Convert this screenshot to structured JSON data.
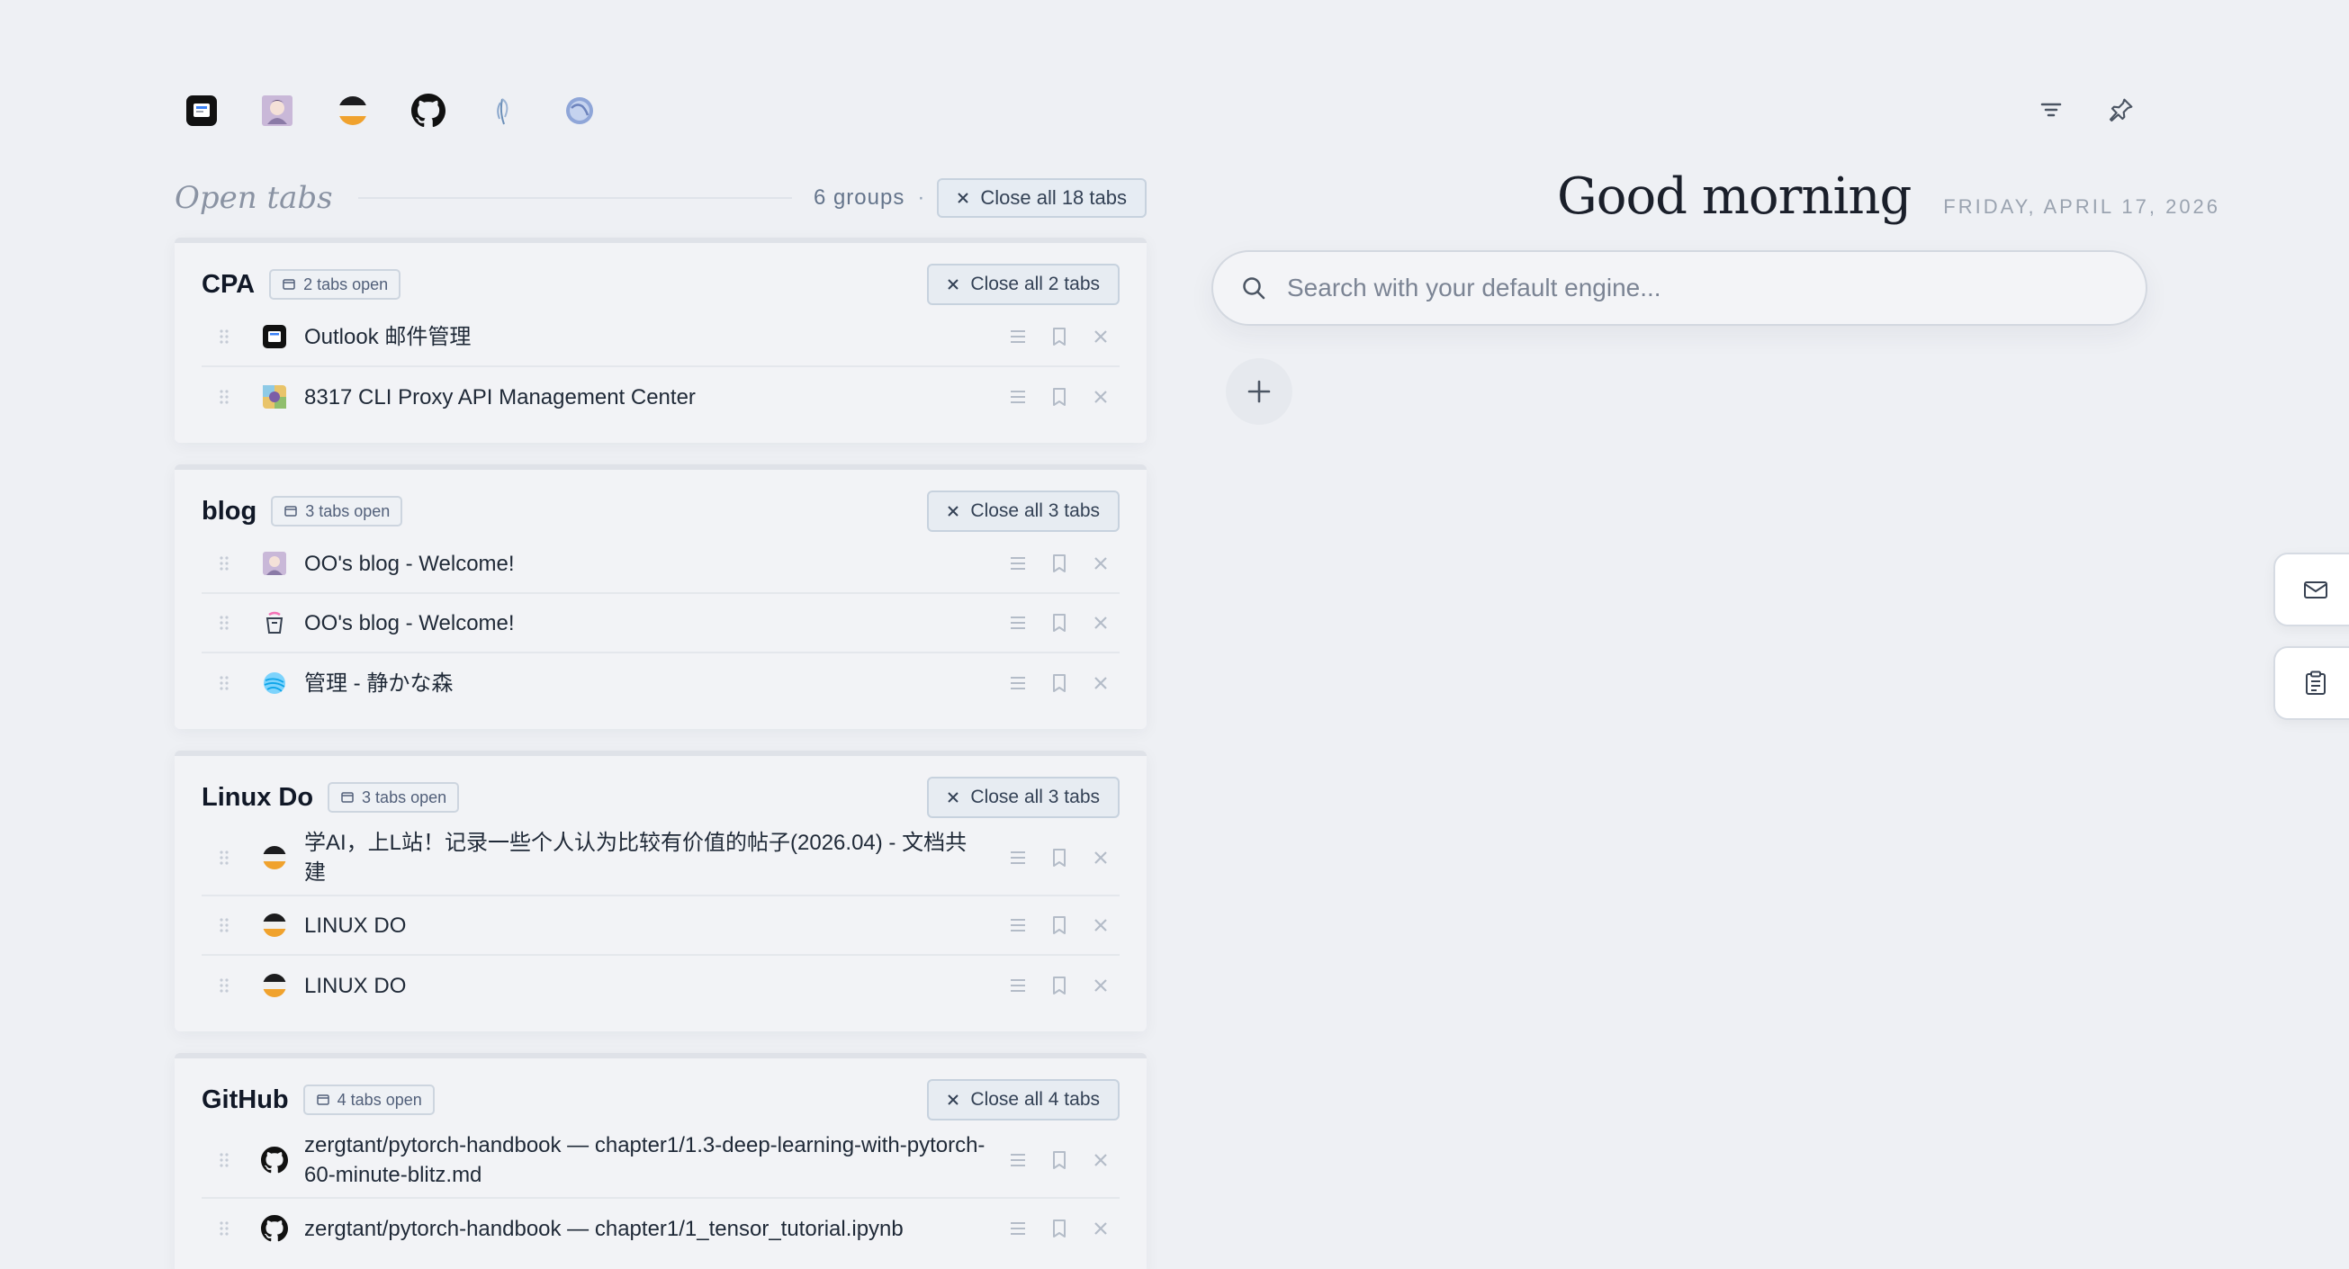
{
  "quick_links": [
    {
      "name": "outlook",
      "icon": "outlook-icon"
    },
    {
      "name": "blog-avatar",
      "icon": "anime-avatar-icon"
    },
    {
      "name": "linux-do",
      "icon": "linuxdo-icon"
    },
    {
      "name": "github",
      "icon": "github-icon"
    },
    {
      "name": "feather",
      "icon": "feather-icon"
    },
    {
      "name": "globe",
      "icon": "globe-icon"
    }
  ],
  "open_tabs": {
    "title": "Open tabs",
    "groups_count": "6 groups",
    "separator": "·",
    "close_all_label": "Close all 18 tabs"
  },
  "groups": [
    {
      "name": "CPA",
      "badge": "2 tabs open",
      "close_label": "Close all 2 tabs",
      "tabs": [
        {
          "title": "Outlook 邮件管理",
          "icon": "outlook-icon"
        },
        {
          "title": "8317 CLI Proxy API Management Center",
          "icon": "proxy-icon"
        }
      ]
    },
    {
      "name": "blog",
      "badge": "3 tabs open",
      "close_label": "Close all 3 tabs",
      "tabs": [
        {
          "title": "OO's blog - Welcome!",
          "icon": "anime-avatar-icon"
        },
        {
          "title": "OO's blog - Welcome!",
          "icon": "cup-icon"
        },
        {
          "title": "管理 - 静かな森",
          "icon": "yarn-ball-icon"
        }
      ]
    },
    {
      "name": "Linux Do",
      "badge": "3 tabs open",
      "close_label": "Close all 3 tabs",
      "tabs": [
        {
          "title": "学AI，上L站！记录一些个人认为比较有价值的帖子(2026.04) - 文档共建",
          "icon": "linuxdo-icon"
        },
        {
          "title": "LINUX DO",
          "icon": "linuxdo-icon"
        },
        {
          "title": "LINUX DO",
          "icon": "linuxdo-icon"
        }
      ]
    },
    {
      "name": "GitHub",
      "badge": "4 tabs open",
      "close_label": "Close all 4 tabs",
      "tabs": [
        {
          "title": "zergtant/pytorch-handbook — chapter1/1.3-deep-learning-with-pytorch-60-minute-blitz.md",
          "icon": "github-icon"
        },
        {
          "title": "zergtant/pytorch-handbook — chapter1/1_tensor_tutorial.ipynb",
          "icon": "github-icon"
        }
      ]
    }
  ],
  "greeting": "Good morning",
  "date": "FRIDAY, APRIL 17, 2026",
  "search": {
    "placeholder": "Search with your default engine..."
  },
  "colors": {
    "background": "#eef0f4",
    "accent_border": "#c7d2de",
    "linuxdo_orange": "#f0a22d"
  }
}
